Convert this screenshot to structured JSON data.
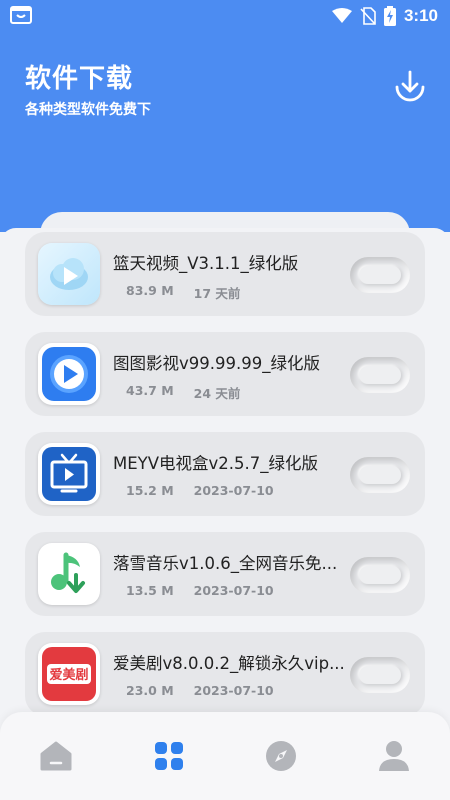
{
  "status_bar": {
    "time": "3:10"
  },
  "header": {
    "title": "软件下载",
    "subtitle": "各种类型软件免费下"
  },
  "apps": [
    {
      "name": "篮天视频_V3.1.1_绿化版",
      "size": "83.9 M",
      "date": "17 天前",
      "icon": "blue-cloud-play-icon"
    },
    {
      "name": "图图影视v99.99.99_绿化版",
      "size": "43.7 M",
      "date": "24 天前",
      "icon": "blue-play-icon"
    },
    {
      "name": "MEYV电视盒v2.5.7_绿化版",
      "size": "15.2 M",
      "date": "2023-07-10",
      "icon": "tv-play-icon"
    },
    {
      "name": "落雪音乐v1.0.6_全网音乐免...",
      "size": "13.5 M",
      "date": "2023-07-10",
      "icon": "music-note-download-icon"
    },
    {
      "name": "爱美剧v8.0.0.2_解锁永久vip...",
      "size": "23.0 M",
      "date": "2023-07-10",
      "icon": "aimeiju-logo-icon",
      "logo_text": "爱美剧"
    }
  ],
  "nav": [
    "home-icon",
    "apps-grid-icon",
    "compass-icon",
    "profile-icon"
  ],
  "colors": {
    "primary": "#4c8cf2",
    "active_nav": "#2f80ed",
    "inactive_nav": "#b3b5ba"
  }
}
